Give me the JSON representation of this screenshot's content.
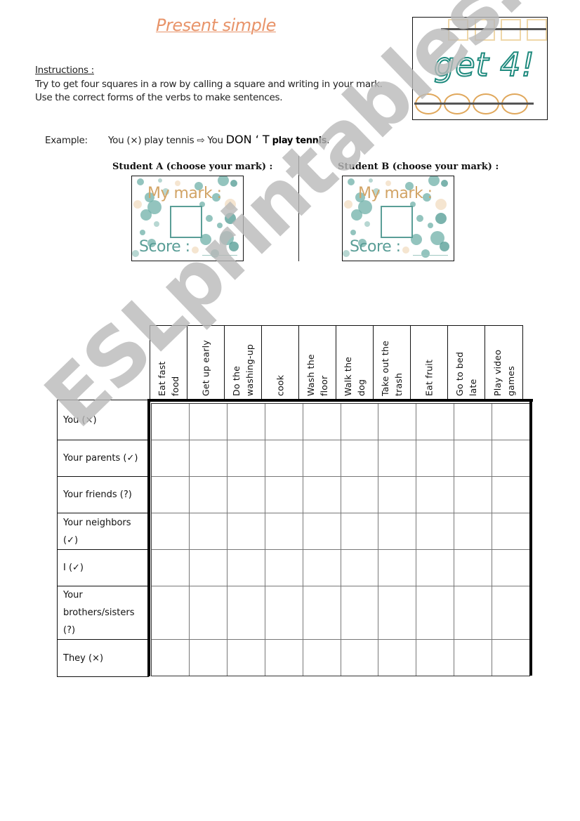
{
  "title": "Present simple",
  "instructions": {
    "heading": "Instructions :",
    "line1": "Try to get four squares in a row by calling a square and writing in your mark.",
    "line2": "Use the correct forms of the verbs to make sentences."
  },
  "example": {
    "label": "Example:",
    "prompt": "You (×) play tennis ⇨ You",
    "answer_caps": "DON ‘ T",
    "answer_rest": "play tennis",
    "end": "."
  },
  "logo": {
    "text": "get 4!",
    "square_count": 4,
    "circle_count": 4,
    "colors": {
      "text_outline": "#1f8a7e",
      "squares": "#efd7a8",
      "circles": "#e0a85c"
    }
  },
  "students": [
    {
      "label": "Student A   (choose your mark) :",
      "mark_label": "My mark :",
      "score_label": "Score :"
    },
    {
      "label": "Student B (choose your mark) :",
      "mark_label": "My mark :",
      "score_label": "Score :"
    }
  ],
  "grid": {
    "columns": [
      "Eat fast\nfood",
      "Get up early",
      "Do the\nwashing-up",
      "cook",
      "Wash the\nfloor",
      "Walk the\ndog",
      "Take out the\ntrash",
      "Eat fruit",
      "Go to bed\nlate",
      "Play video\ngames"
    ],
    "rows": [
      "You (×)",
      "Your parents (✓)",
      "Your friends (?)",
      "Your neighbors (✓)",
      "I (✓)",
      "Your brothers/sisters (?)",
      "They (×)"
    ]
  },
  "watermark": "ESLprintables.com",
  "colors": {
    "title": "#e8946a",
    "mark_label": "#d2a466",
    "score_label": "#5a9e97"
  }
}
